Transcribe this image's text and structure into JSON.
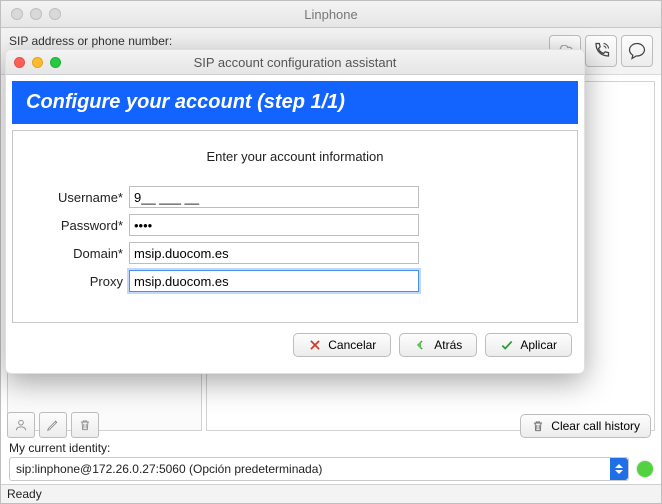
{
  "main_window": {
    "title": "Linphone",
    "sip_label": "SIP address or phone number:",
    "sip_value": ""
  },
  "dialog": {
    "title": "SIP account configuration assistant",
    "headline": "Configure your account (step 1/1)",
    "subtitle": "Enter your account information",
    "fields": {
      "username_label": "Username*",
      "username_value": "9__ ___ __",
      "password_label": "Password*",
      "password_value": "••••",
      "domain_label": "Domain*",
      "domain_value": "msip.duocom.es",
      "proxy_label": "Proxy",
      "proxy_value": "msip.duocom.es"
    },
    "buttons": {
      "cancel": "Cancelar",
      "back": "Atrás",
      "apply": "Aplicar"
    }
  },
  "bottom": {
    "clear_history": "Clear call history",
    "identity_label": "My current identity:",
    "identity_value": "sip:linphone@172.26.0.27:5060 (Opción predeterminada)",
    "status_text": "Ready"
  },
  "colors": {
    "accent": "#1364ff",
    "online": "#52d142"
  }
}
